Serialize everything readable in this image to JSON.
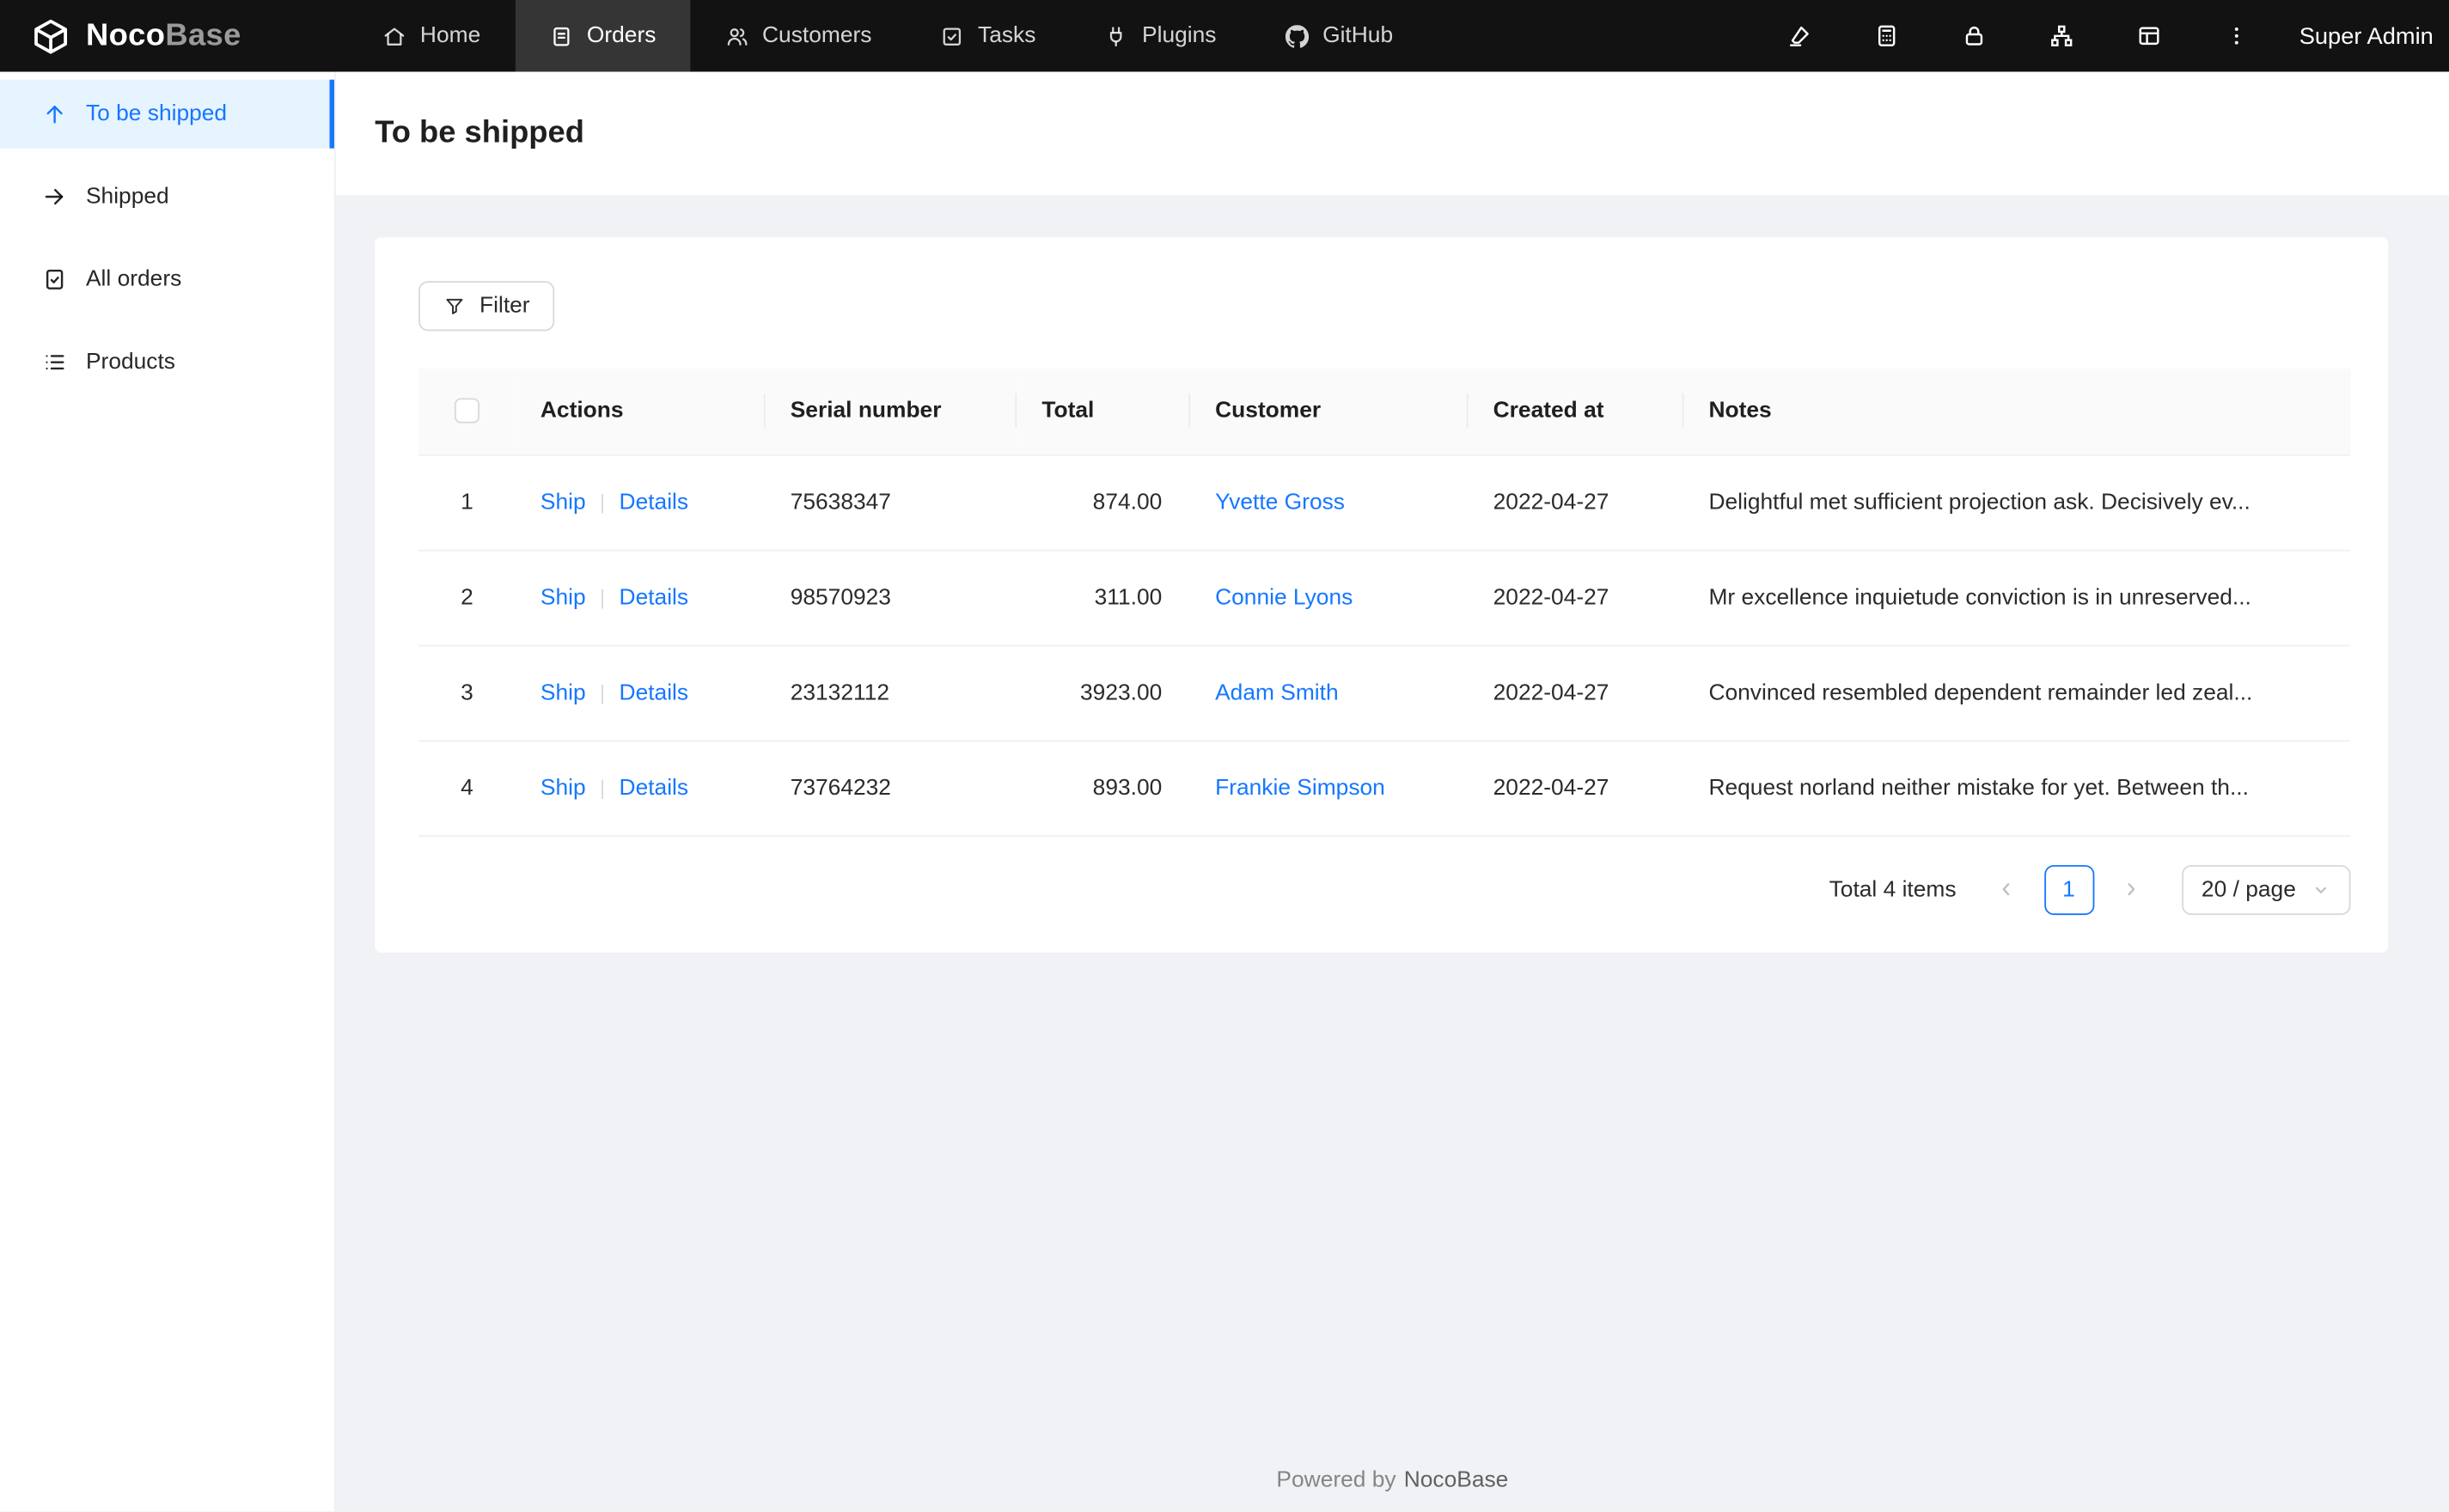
{
  "colors": {
    "accent": "#1677ff",
    "navbar_bg": "#121212",
    "sidebar_active_bg": "#e6f4ff"
  },
  "navbar": {
    "logo_primary": "Noco",
    "logo_secondary": "Base",
    "items": [
      {
        "label": "Home",
        "icon": "home-icon",
        "active": false
      },
      {
        "label": "Orders",
        "icon": "orders-icon",
        "active": true
      },
      {
        "label": "Customers",
        "icon": "customers-icon",
        "active": false
      },
      {
        "label": "Tasks",
        "icon": "tasks-icon",
        "active": false
      },
      {
        "label": "Plugins",
        "icon": "plugins-icon",
        "active": false
      },
      {
        "label": "GitHub",
        "icon": "github-icon",
        "active": false
      }
    ],
    "action_icons": [
      "ui-editor-icon",
      "calculator-icon",
      "lock-icon",
      "collaboration-icon",
      "layout-icon",
      "more-icon"
    ],
    "user": "Super Admin"
  },
  "sidebar": {
    "items": [
      {
        "label": "To be shipped",
        "icon": "arrow-up-icon",
        "active": true
      },
      {
        "label": "Shipped",
        "icon": "arrow-right-icon",
        "active": false
      },
      {
        "label": "All orders",
        "icon": "order-file-icon",
        "active": false
      },
      {
        "label": "Products",
        "icon": "list-icon",
        "active": false
      }
    ]
  },
  "page": {
    "title": "To be shipped"
  },
  "toolbar": {
    "filter_label": "Filter"
  },
  "table": {
    "headers": {
      "actions": "Actions",
      "serial": "Serial number",
      "total": "Total",
      "customer": "Customer",
      "created": "Created at",
      "notes": "Notes"
    },
    "action_labels": {
      "ship": "Ship",
      "divider": "|",
      "details": "Details"
    },
    "rows": [
      {
        "index": "1",
        "serial": "75638347",
        "total": "874.00",
        "customer": "Yvette Gross",
        "created": "2022-04-27",
        "notes": "Delightful met sufficient projection ask. Decisively ev..."
      },
      {
        "index": "2",
        "serial": "98570923",
        "total": "311.00",
        "customer": "Connie Lyons",
        "created": "2022-04-27",
        "notes": "Mr excellence inquietude conviction is in unreserved..."
      },
      {
        "index": "3",
        "serial": "23132112",
        "total": "3923.00",
        "customer": "Adam Smith",
        "created": "2022-04-27",
        "notes": "Convinced resembled dependent remainder led zeal..."
      },
      {
        "index": "4",
        "serial": "73764232",
        "total": "893.00",
        "customer": "Frankie Simpson",
        "created": "2022-04-27",
        "notes": "Request norland neither mistake for yet. Between th..."
      }
    ]
  },
  "pagination": {
    "total_text": "Total 4 items",
    "current_page": "1",
    "page_size": "20 / page"
  },
  "footer": {
    "prefix": "Powered by",
    "brand": "NocoBase"
  }
}
